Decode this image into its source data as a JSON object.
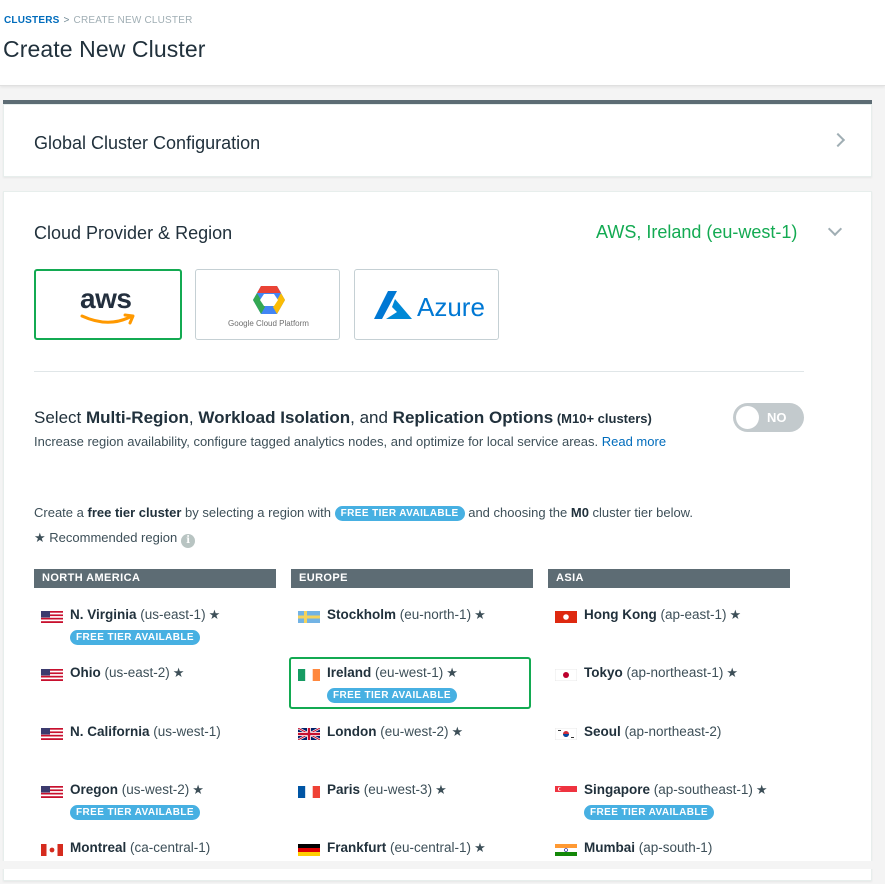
{
  "breadcrumb": {
    "parent": "CLUSTERS",
    "separator": ">",
    "current": "CREATE NEW CLUSTER"
  },
  "page_title": "Create New Cluster",
  "global_config": {
    "title": "Global Cluster Configuration"
  },
  "cloud_section": {
    "title": "Cloud Provider & Region",
    "selected_summary": "AWS, Ireland (eu-west-1)",
    "providers": {
      "aws": {
        "label": "aws",
        "selected": true
      },
      "gcp": {
        "label": "Google Cloud Platform"
      },
      "azure": {
        "label": "Azure"
      }
    }
  },
  "multi_region": {
    "prefix": "Select ",
    "opt1": "Multi-Region",
    "sep1": ", ",
    "opt2": "Workload Isolation",
    "sep2": ", and ",
    "opt3": "Replication Options",
    "suffix": " (M10+ clusters)",
    "description": "Increase region availability, configure tagged analytics nodes, and optimize for local service areas. ",
    "read_more": "Read more",
    "toggle_label": "NO"
  },
  "free_tier": {
    "t1": "Create a ",
    "t2": "free tier cluster",
    "t3": " by selecting a region with ",
    "badge": "FREE TIER AVAILABLE",
    "t4": " and choosing the ",
    "t5": "M0",
    "t6": " cluster tier below."
  },
  "recommended": {
    "label": "Recommended region",
    "star_icon": "★"
  },
  "columns": {
    "north_america": {
      "header": "NORTH AMERICA",
      "regions": [
        {
          "name": "N. Virginia",
          "code": "(us-east-1)",
          "star": "★",
          "badge": "FREE TIER AVAILABLE"
        },
        {
          "name": "Ohio",
          "code": "(us-east-2)",
          "star": "★"
        },
        {
          "name": "N. California",
          "code": "(us-west-1)"
        },
        {
          "name": "Oregon",
          "code": "(us-west-2)",
          "star": "★",
          "badge": "FREE TIER AVAILABLE"
        },
        {
          "name": "Montreal",
          "code": "(ca-central-1)"
        }
      ]
    },
    "europe": {
      "header": "EUROPE",
      "regions": [
        {
          "name": "Stockholm",
          "code": "(eu-north-1)",
          "star": "★"
        },
        {
          "name": "Ireland",
          "code": "(eu-west-1)",
          "star": "★",
          "badge": "FREE TIER AVAILABLE",
          "selected": true
        },
        {
          "name": "London",
          "code": "(eu-west-2)",
          "star": "★"
        },
        {
          "name": "Paris",
          "code": "(eu-west-3)",
          "star": "★"
        },
        {
          "name": "Frankfurt",
          "code": "(eu-central-1)",
          "star": "★"
        }
      ]
    },
    "asia": {
      "header": "ASIA",
      "regions": [
        {
          "name": "Hong Kong",
          "code": "(ap-east-1)",
          "star": "★"
        },
        {
          "name": "Tokyo",
          "code": "(ap-northeast-1)",
          "star": "★"
        },
        {
          "name": "Seoul",
          "code": "(ap-northeast-2)"
        },
        {
          "name": "Singapore",
          "code": "(ap-southeast-1)",
          "star": "★",
          "badge": "FREE TIER AVAILABLE"
        },
        {
          "name": "Mumbai",
          "code": "(ap-south-1)"
        }
      ]
    }
  },
  "colors": {
    "accent_green": "#13aa52",
    "link_blue": "#006cbc",
    "badge_blue": "#47b0e2",
    "header_gray": "#5d6c74"
  }
}
